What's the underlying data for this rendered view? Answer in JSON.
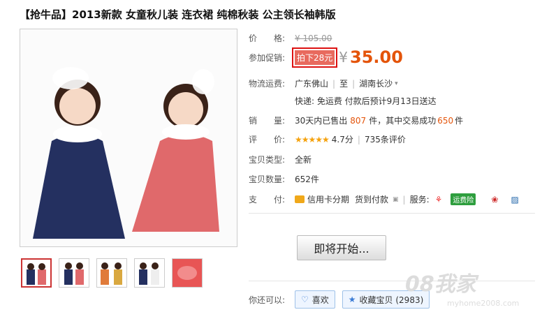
{
  "product": {
    "title": "【抢牛品】2013新款 女童秋儿装 连衣裙 纯棉秋装 公主领长袖韩版"
  },
  "price": {
    "label": "价　　格:",
    "original": "¥ 105.00"
  },
  "promo": {
    "label": "参加促销:",
    "tag": "拍下28元",
    "yen": "¥",
    "price": "35.00"
  },
  "shipping": {
    "label": "物流运费:",
    "from": "广东佛山",
    "to_label": "至",
    "to": "湖南长沙",
    "detail": "快递: 免运费 付款后预计9月13日送达"
  },
  "sales": {
    "label": "销　　量:",
    "prefix": "30天内已售出",
    "sold": "807",
    "mid": "件，其中交易成功",
    "success": "650",
    "suffix": "件"
  },
  "rating": {
    "label": "评　　价:",
    "stars": "★★★★★",
    "score": "4.7分",
    "reviews": "735条评价"
  },
  "type": {
    "label": "宝贝类型:",
    "value": "全新"
  },
  "quantity": {
    "label": "宝贝数量:",
    "value": "652件"
  },
  "payment": {
    "label": "支　　付:",
    "credit": "信用卡分期",
    "cod": "货到付款",
    "service_label": "服务:",
    "insurance": "运费险"
  },
  "buttons": {
    "start": "即将开始..."
  },
  "actions": {
    "label": "你还可以:",
    "like": "喜欢",
    "favorite": "收藏宝贝 (2983)"
  },
  "watermark": {
    "text": "08我家",
    "url": "myhome2008.com"
  },
  "colors": {
    "accent": "#e4540a",
    "promo_bg": "#e86a5e",
    "promo_border": "#d11111"
  }
}
